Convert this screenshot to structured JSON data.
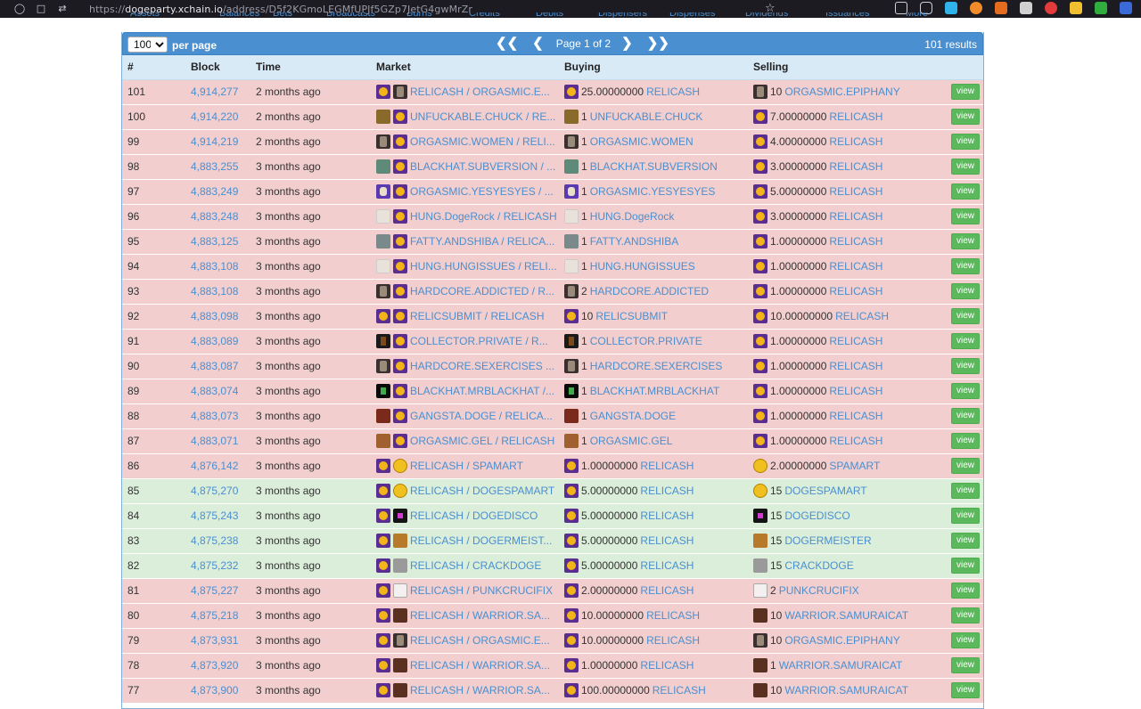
{
  "browser": {
    "url_prefix": "https://",
    "url_host": "dogeparty.xchain.io",
    "url_path": "/address/D5f2KGmoLEGMfUPJf5GZp7JetG4gwMrZr"
  },
  "nav_tabs": [
    "Assets",
    "Balances",
    "Bets",
    "Broadcasts",
    "Burns",
    "Credits",
    "Debits",
    "Dispensers",
    "Dispenses",
    "Dividends",
    "Issuances",
    "More"
  ],
  "pager": {
    "per_page_value": "100",
    "per_page_label": "per page",
    "page_text": "Page 1 of 2",
    "results_text": "101 results",
    "first_icon": "double-chevron-left",
    "prev_icon": "chevron-left",
    "next_icon": "chevron-right",
    "last_icon": "double-chevron-right"
  },
  "columns": [
    "#",
    "Block",
    "Time",
    "Market",
    "Buying",
    "Selling",
    ""
  ],
  "view_label": "view",
  "colors": {
    "sell_row": "#f2cece",
    "buy_row": "#dbeeda",
    "link": "#4a8fd0",
    "pager_bg": "#4a8fd0",
    "view_button": "#5cb85c"
  },
  "rows": [
    {
      "n": "101",
      "block": "4,914,277",
      "time": "2 months ago",
      "side": "sell",
      "m1": "relic",
      "m2": "dark",
      "market": "RELICASH / ORGASMIC.E...",
      "bi": "relic",
      "bq": "25.00000000",
      "ba": "RELICASH",
      "si": "dark",
      "sq": "10",
      "sa": "ORGASMIC.EPIPHANY"
    },
    {
      "n": "100",
      "block": "4,914,220",
      "time": "2 months ago",
      "side": "sell",
      "m1": "brown",
      "m2": "relic",
      "market": "UNFUCKABLE.CHUCK / RE...",
      "bi": "brown",
      "bq": "1",
      "ba": "UNFUCKABLE.CHUCK",
      "si": "relic",
      "sq": "7.00000000",
      "sa": "RELICASH"
    },
    {
      "n": "99",
      "block": "4,914,219",
      "time": "2 months ago",
      "side": "sell",
      "m1": "dark",
      "m2": "relic",
      "market": "ORGASMIC.WOMEN / RELI...",
      "bi": "dark",
      "bq": "1",
      "ba": "ORGASMIC.WOMEN",
      "si": "relic",
      "sq": "4.00000000",
      "sa": "RELICASH"
    },
    {
      "n": "98",
      "block": "4,883,255",
      "time": "3 months ago",
      "side": "sell",
      "m1": "teal",
      "m2": "relic",
      "market": "BLACKHAT.SUBVERSION / ...",
      "bi": "teal",
      "bq": "1",
      "ba": "BLACKHAT.SUBVERSION",
      "si": "relic",
      "sq": "3.00000000",
      "sa": "RELICASH"
    },
    {
      "n": "97",
      "block": "4,883,249",
      "time": "3 months ago",
      "side": "sell",
      "m1": "purple",
      "m2": "relic",
      "market": "ORGASMIC.YESYESYES / ...",
      "bi": "purple",
      "bq": "1",
      "ba": "ORGASMIC.YESYESYES",
      "si": "relic",
      "sq": "5.00000000",
      "sa": "RELICASH"
    },
    {
      "n": "96",
      "block": "4,883,248",
      "time": "3 months ago",
      "side": "sell",
      "m1": "light",
      "m2": "relic",
      "market": "HUNG.DogeRock / RELICASH",
      "bi": "light",
      "bq": "1",
      "ba": "HUNG.DogeRock",
      "si": "relic",
      "sq": "3.00000000",
      "sa": "RELICASH"
    },
    {
      "n": "95",
      "block": "4,883,125",
      "time": "3 months ago",
      "side": "sell",
      "m1": "fatty",
      "m2": "relic",
      "market": "FATTY.ANDSHIBA / RELICA...",
      "bi": "fatty",
      "bq": "1",
      "ba": "FATTY.ANDSHIBA",
      "si": "relic",
      "sq": "1.00000000",
      "sa": "RELICASH"
    },
    {
      "n": "94",
      "block": "4,883,108",
      "time": "3 months ago",
      "side": "sell",
      "m1": "light",
      "m2": "relic",
      "market": "HUNG.HUNGISSUES / RELI...",
      "bi": "light",
      "bq": "1",
      "ba": "HUNG.HUNGISSUES",
      "si": "relic",
      "sq": "1.00000000",
      "sa": "RELICASH"
    },
    {
      "n": "93",
      "block": "4,883,108",
      "time": "3 months ago",
      "side": "sell",
      "m1": "dark",
      "m2": "relic",
      "market": "HARDCORE.ADDICTED / R...",
      "bi": "dark",
      "bq": "2",
      "ba": "HARDCORE.ADDICTED",
      "si": "relic",
      "sq": "1.00000000",
      "sa": "RELICASH"
    },
    {
      "n": "92",
      "block": "4,883,098",
      "time": "3 months ago",
      "side": "sell",
      "m1": "relic",
      "m2": "relic",
      "market": "RELICSUBMIT / RELICASH",
      "bi": "relic",
      "bq": "10",
      "ba": "RELICSUBMIT",
      "si": "relic",
      "sq": "10.00000000",
      "sa": "RELICASH"
    },
    {
      "n": "91",
      "block": "4,883,089",
      "time": "3 months ago",
      "side": "sell",
      "m1": "collector",
      "m2": "relic",
      "market": "COLLECTOR.PRIVATE / R...",
      "bi": "collector",
      "bq": "1",
      "ba": "COLLECTOR.PRIVATE",
      "si": "relic",
      "sq": "1.00000000",
      "sa": "RELICASH"
    },
    {
      "n": "90",
      "block": "4,883,087",
      "time": "3 months ago",
      "side": "sell",
      "m1": "dark",
      "m2": "relic",
      "market": "HARDCORE.SEXERCISES ...",
      "bi": "dark",
      "bq": "1",
      "ba": "HARDCORE.SEXERCISES",
      "si": "relic",
      "sq": "1.00000000",
      "sa": "RELICASH"
    },
    {
      "n": "89",
      "block": "4,883,074",
      "time": "3 months ago",
      "side": "sell",
      "m1": "black",
      "m2": "relic",
      "market": "BLACKHAT.MRBLACKHAT /...",
      "bi": "black",
      "bq": "1",
      "ba": "BLACKHAT.MRBLACKHAT",
      "si": "relic",
      "sq": "1.00000000",
      "sa": "RELICASH"
    },
    {
      "n": "88",
      "block": "4,883,073",
      "time": "3 months ago",
      "side": "sell",
      "m1": "gang",
      "m2": "relic",
      "market": "GANGSTA.DOGE / RELICA...",
      "bi": "gang",
      "bq": "1",
      "ba": "GANGSTA.DOGE",
      "si": "relic",
      "sq": "1.00000000",
      "sa": "RELICASH"
    },
    {
      "n": "87",
      "block": "4,883,071",
      "time": "3 months ago",
      "side": "sell",
      "m1": "gel",
      "m2": "relic",
      "market": "ORGASMIC.GEL / RELICASH",
      "bi": "gel",
      "bq": "1",
      "ba": "ORGASMIC.GEL",
      "si": "relic",
      "sq": "1.00000000",
      "sa": "RELICASH"
    },
    {
      "n": "86",
      "block": "4,876,142",
      "time": "3 months ago",
      "side": "sell",
      "m1": "relic",
      "m2": "spam",
      "market": "RELICASH / SPAMART",
      "bi": "relic",
      "bq": "1.00000000",
      "ba": "RELICASH",
      "si": "spam",
      "sq": "2.00000000",
      "sa": "SPAMART"
    },
    {
      "n": "85",
      "block": "4,875,270",
      "time": "3 months ago",
      "side": "buy",
      "m1": "relic",
      "m2": "spam",
      "market": "RELICASH / DOGESPAMART",
      "bi": "relic",
      "bq": "5.00000000",
      "ba": "RELICASH",
      "si": "spam",
      "sq": "15",
      "sa": "DOGESPAMART"
    },
    {
      "n": "84",
      "block": "4,875,243",
      "time": "3 months ago",
      "side": "buy",
      "m1": "relic",
      "m2": "disco",
      "market": "RELICASH / DOGEDISCO",
      "bi": "relic",
      "bq": "5.00000000",
      "ba": "RELICASH",
      "si": "disco",
      "sq": "15",
      "sa": "DOGEDISCO"
    },
    {
      "n": "83",
      "block": "4,875,238",
      "time": "3 months ago",
      "side": "buy",
      "m1": "relic",
      "m2": "meister",
      "market": "RELICASH / DOGERMEIST...",
      "bi": "relic",
      "bq": "5.00000000",
      "ba": "RELICASH",
      "si": "meister",
      "sq": "15",
      "sa": "DOGERMEISTER"
    },
    {
      "n": "82",
      "block": "4,875,232",
      "time": "3 months ago",
      "side": "buy",
      "m1": "relic",
      "m2": "crack",
      "market": "RELICASH / CRACKDOGE",
      "bi": "relic",
      "bq": "5.00000000",
      "ba": "RELICASH",
      "si": "crack",
      "sq": "15",
      "sa": "CRACKDOGE"
    },
    {
      "n": "81",
      "block": "4,875,227",
      "time": "3 months ago",
      "side": "sell",
      "m1": "relic",
      "m2": "punk",
      "market": "RELICASH / PUNKCRUCIFIX",
      "bi": "relic",
      "bq": "2.00000000",
      "ba": "RELICASH",
      "si": "punk",
      "sq": "2",
      "sa": "PUNKCRUCIFIX"
    },
    {
      "n": "80",
      "block": "4,875,218",
      "time": "3 months ago",
      "side": "sell",
      "m1": "relic",
      "m2": "warrior",
      "market": "RELICASH / WARRIOR.SA...",
      "bi": "relic",
      "bq": "10.00000000",
      "ba": "RELICASH",
      "si": "warrior",
      "sq": "10",
      "sa": "WARRIOR.SAMURAICAT"
    },
    {
      "n": "79",
      "block": "4,873,931",
      "time": "3 months ago",
      "side": "sell",
      "m1": "relic",
      "m2": "dark",
      "market": "RELICASH / ORGASMIC.E...",
      "bi": "relic",
      "bq": "10.00000000",
      "ba": "RELICASH",
      "si": "dark",
      "sq": "10",
      "sa": "ORGASMIC.EPIPHANY"
    },
    {
      "n": "78",
      "block": "4,873,920",
      "time": "3 months ago",
      "side": "sell",
      "m1": "relic",
      "m2": "warrior",
      "market": "RELICASH / WARRIOR.SA...",
      "bi": "relic",
      "bq": "1.00000000",
      "ba": "RELICASH",
      "si": "warrior",
      "sq": "1",
      "sa": "WARRIOR.SAMURAICAT"
    },
    {
      "n": "77",
      "block": "4,873,900",
      "time": "3 months ago",
      "side": "sell",
      "m1": "relic",
      "m2": "warrior",
      "market": "RELICASH / WARRIOR.SA...",
      "bi": "relic",
      "bq": "100.00000000",
      "ba": "RELICASH",
      "si": "warrior",
      "sq": "10",
      "sa": "WARRIOR.SAMURAICAT"
    }
  ]
}
